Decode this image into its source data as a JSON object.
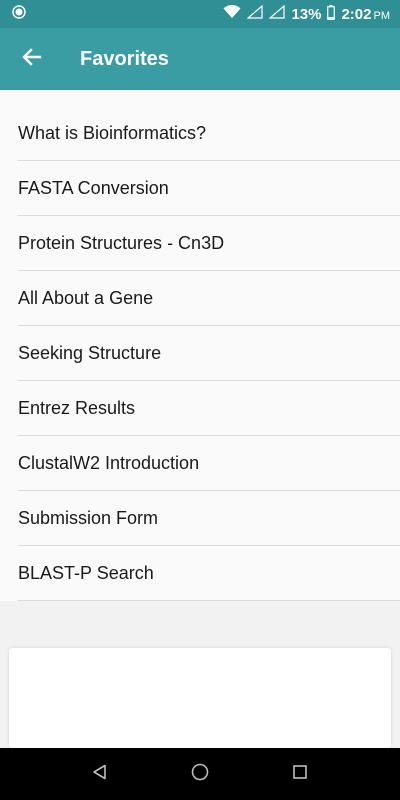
{
  "status_bar": {
    "battery_percent": "13%",
    "time": "2:02",
    "ampm": "PM",
    "icons": [
      "circle-notification-icon",
      "wifi-icon",
      "signal-icon",
      "signal-icon",
      "battery-icon"
    ]
  },
  "app_bar": {
    "back_icon": "arrow-left-icon",
    "title": "Favorites"
  },
  "favorites": [
    "What is Bioinformatics?",
    "FASTA Conversion",
    "Protein Structures - Cn3D",
    "All About a Gene",
    "Seeking Structure",
    "Entrez Results",
    "ClustalW2 Introduction",
    "Submission Form",
    "BLAST-P Search"
  ],
  "nav_bar": {
    "icons": [
      "back-triangle-icon",
      "home-circle-icon",
      "recents-square-icon"
    ]
  },
  "colors": {
    "status_bar": "#2f8f95",
    "app_bar": "#3a9da3",
    "list_background": "#fafafa"
  }
}
